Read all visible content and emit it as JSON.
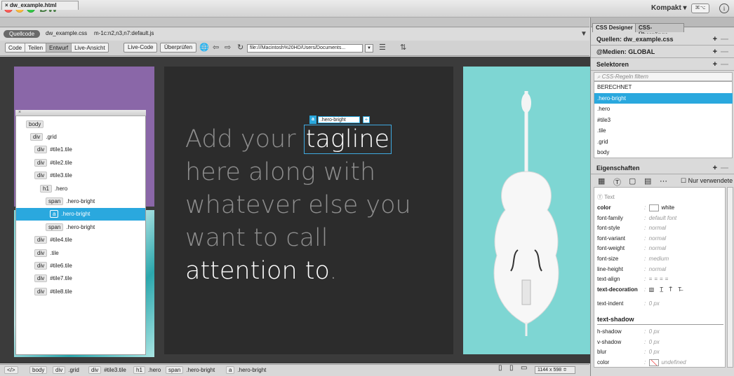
{
  "app": {
    "logo": "Dw",
    "workspace": "Kompakt ▾",
    "workspace_icon": "⌘⌥",
    "info_icon": "i"
  },
  "document": {
    "tab": "dw_example.html",
    "source_label": "Quellcode",
    "related_files": [
      "dw_example.css",
      "m-1c:n2,n3,n7:default.js"
    ]
  },
  "toolbar": {
    "view_buttons": [
      "Code",
      "Teilen",
      "Entwurf",
      "Live-Ansicht"
    ],
    "active_view": "Entwurf",
    "live_code": "Live-Code",
    "inspect": "Überprüfen",
    "url": "file:///Macintosh%20HD/Users/Documents..."
  },
  "hero": {
    "line1": "Add your ",
    "highlight": "tagline",
    "line2": "here along with",
    "line3": "whatever else you",
    "line4": "want to call",
    "line5": "attention to",
    "period": "."
  },
  "selection_badge": {
    "tag": "a",
    "class": ".hero-bright",
    "plus": "+"
  },
  "dom_panel": {
    "close": "×",
    "nodes": [
      {
        "tag": "body",
        "label": ""
      },
      {
        "tag": "div",
        "label": ".grid"
      },
      {
        "tag": "div",
        "label": "#tile1.tile"
      },
      {
        "tag": "div",
        "label": "#tile2.tile"
      },
      {
        "tag": "div",
        "label": "#tile3.tile"
      },
      {
        "tag": "h1",
        "label": ".hero"
      },
      {
        "tag": "span",
        "label": ".hero-bright"
      },
      {
        "tag": "a",
        "label": ".hero-bright"
      },
      {
        "tag": "span",
        "label": ".hero-bright"
      },
      {
        "tag": "div",
        "label": "#tile4.tile"
      },
      {
        "tag": "div",
        "label": ".tile"
      },
      {
        "tag": "div",
        "label": "#tile6.tile"
      },
      {
        "tag": "div",
        "label": "#tile7.tile"
      },
      {
        "tag": "div",
        "label": "#tile8.tile"
      }
    ],
    "selected_index": 7
  },
  "statusbar": {
    "code_icon": "</>",
    "crumbs": [
      {
        "tag": "body",
        "label": ""
      },
      {
        "tag": "div",
        "label": ".grid"
      },
      {
        "tag": "div",
        "label": "#tile3.tile"
      },
      {
        "tag": "h1",
        "label": ".hero"
      },
      {
        "tag": "span",
        "label": ".hero-bright"
      },
      {
        "tag": "a",
        "label": ".hero-bright"
      }
    ],
    "resolution": "1144 x 598 ≑"
  },
  "css_designer": {
    "tabs": [
      "CSS Designer",
      "CSS-Übergänge"
    ],
    "sources": "Quellen: dw_example.css",
    "media": "@Medien: GLOBAL",
    "selectors_title": "Selektoren",
    "filter_placeholder": "CSS-Regeln filtern",
    "selectors": [
      "BERECHNET",
      ".hero-bright",
      ".hero",
      "#tile3",
      ".tile",
      ".grid",
      "body"
    ],
    "selected_selector": ".hero-bright",
    "properties_title": "Eigenschaften",
    "only_used": "Nur verwendete",
    "text_group": "Text",
    "properties": [
      {
        "name": "color",
        "value": "white",
        "bold": true
      },
      {
        "name": "font-family",
        "value": "default font"
      },
      {
        "name": "font-style",
        "value": "normal"
      },
      {
        "name": "font-variant",
        "value": "normal"
      },
      {
        "name": "font-weight",
        "value": "normal"
      },
      {
        "name": "font-size",
        "value": "medium"
      },
      {
        "name": "line-height",
        "value": "normal"
      },
      {
        "name": "text-align",
        "value": ""
      },
      {
        "name": "text-decoration",
        "value": "",
        "bold": true
      },
      {
        "name": "text-indent",
        "value": "0 px"
      }
    ],
    "shadow_title": "text-shadow",
    "shadow": [
      {
        "name": "h-shadow",
        "value": "0 px"
      },
      {
        "name": "v-shadow",
        "value": "0 px"
      },
      {
        "name": "blur",
        "value": "0 px"
      },
      {
        "name": "color",
        "value": "undefined"
      }
    ]
  },
  "colors": {
    "accent": "#2aa8de",
    "purple_tile": "#8a67a8",
    "violin_bg": "#7ed6d3",
    "hero_bg": "#2c2c2c"
  }
}
